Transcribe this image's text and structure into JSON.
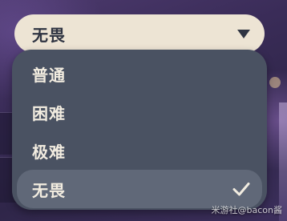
{
  "dropdown": {
    "selected_value": "无畏",
    "options": [
      {
        "label": "普通",
        "selected": false
      },
      {
        "label": "困难",
        "selected": false
      },
      {
        "label": "极难",
        "selected": false
      },
      {
        "label": "无畏",
        "selected": true
      }
    ]
  },
  "watermark": "米游社@bacon酱",
  "colors": {
    "select_bg": "#ede4d4",
    "menu_bg": "#4a5262",
    "selected_option_bg": "#606878",
    "option_text": "#f2ece0",
    "select_text": "#2f3442"
  }
}
